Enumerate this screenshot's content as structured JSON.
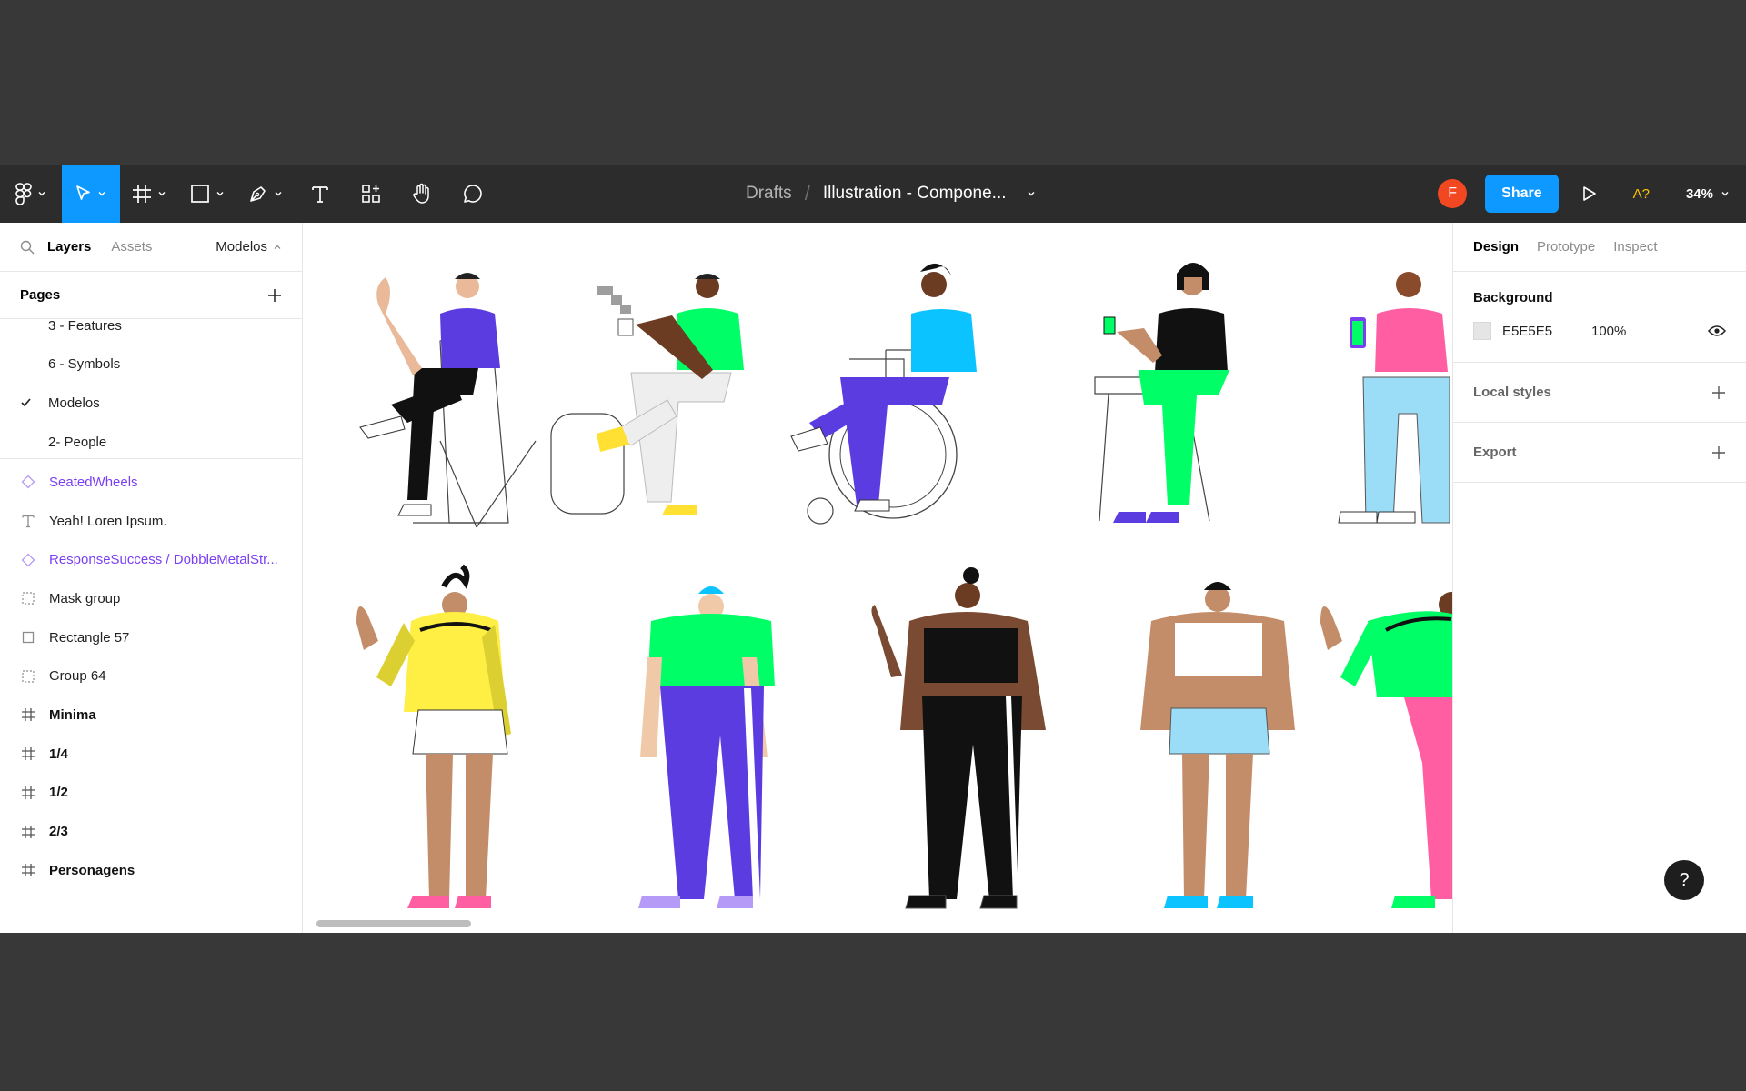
{
  "toolbar": {
    "breadcrumb_root": "Drafts",
    "breadcrumb_sep": "/",
    "file_name": "Illustration - Compone...",
    "avatar_initial": "F",
    "share_label": "Share",
    "missing_fonts": "A?",
    "zoom": "34%"
  },
  "left_panel": {
    "tabs": [
      "Layers",
      "Assets"
    ],
    "current_page": "Modelos",
    "pages_heading": "Pages",
    "pages": [
      "3 - Features",
      "6 - Symbols",
      "Modelos",
      "2- People"
    ],
    "layers": [
      {
        "name": "SeatedWheels",
        "kind": "component"
      },
      {
        "name": "Yeah! Loren Ipsum.",
        "kind": "text"
      },
      {
        "name": "ResponseSuccess / DobbleMetalStr...",
        "kind": "component"
      },
      {
        "name": "Mask group",
        "kind": "group"
      },
      {
        "name": "Rectangle 57",
        "kind": "rect"
      },
      {
        "name": "Group 64",
        "kind": "group"
      },
      {
        "name": "Minima",
        "kind": "frame"
      },
      {
        "name": "1/4",
        "kind": "frame"
      },
      {
        "name": "1/2",
        "kind": "frame"
      },
      {
        "name": "2/3",
        "kind": "frame"
      },
      {
        "name": "Personagens",
        "kind": "frame"
      }
    ]
  },
  "right_panel": {
    "tabs": [
      "Design",
      "Prototype",
      "Inspect"
    ],
    "background_title": "Background",
    "background_hex": "E5E5E5",
    "background_opacity": "100%",
    "local_styles_title": "Local styles",
    "export_title": "Export",
    "help": "?"
  },
  "colors": {
    "toolbar_bg": "#2c2c2c",
    "accent": "#0d99ff",
    "component": "#7b3ff2",
    "avatar": "#f24822",
    "missing_fonts": "#ffc700",
    "background_swatch": "#e5e5e5"
  },
  "icons": [
    "figma-menu-icon",
    "move-icon",
    "frame-icon",
    "shape-icon",
    "pen-icon",
    "text-icon",
    "resources-icon",
    "hand-icon",
    "comment-icon",
    "play-icon",
    "search-icon",
    "eye-icon",
    "plus-icon",
    "help-icon"
  ]
}
